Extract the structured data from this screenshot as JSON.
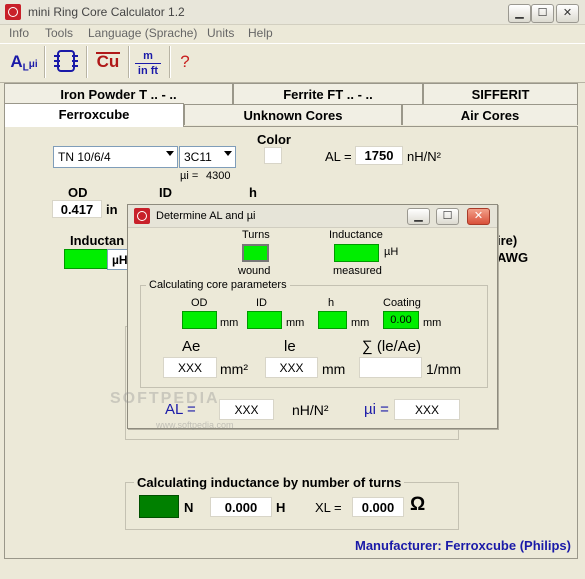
{
  "window": {
    "title": "mini Ring Core Calculator 1.2",
    "min_glyph": "▁",
    "max_glyph": "☐",
    "close_glyph": "✕"
  },
  "menu": [
    "Info",
    "Tools",
    "Language (Sprache)",
    "Units",
    "Help"
  ],
  "toolbar": {
    "al_main": "A",
    "al_sub": "L",
    "mu": "μi",
    "cu": "Cu",
    "m_top": "m",
    "m_bottom": "in ft",
    "help": "?"
  },
  "tabs_row1": [
    "Iron Powder T .. - ..",
    "Ferrite FT .. - ..",
    "SIFFERIT"
  ],
  "tabs_row2": [
    "Ferroxcube",
    "Unknown Cores",
    "Air Cores"
  ],
  "main": {
    "core_select": "TN 10/6/4",
    "material_select": "3C11",
    "mu_label": "µi =",
    "mu_value": "4300",
    "color_label": "Color",
    "al_label": "AL =",
    "al_value": "1750",
    "al_unit": "nH/N²",
    "od_label": "OD",
    "od_value": "0.417",
    "od_unit": "in",
    "id_label": "ID",
    "h_label": "h",
    "inductance_label_partial": "Inductan",
    "uh_partial": "µH",
    "wire_partial": "ire)",
    "awg_partial": "AWG",
    "calc_by_turns_title": "Calculating inductance by number of turns",
    "n_label": "N",
    "n_value": "0.000",
    "h_unit": "H",
    "xl_label": "XL =",
    "xl_value": "0.000",
    "ohm": "Ω",
    "manufacturer": "Manufacturer: Ferroxcube (Philips)"
  },
  "dialog": {
    "title": "Determine AL and µi",
    "turns_label": "Turns",
    "wound_label": "wound",
    "inductance_label": "Inductance",
    "measured_label": "measured",
    "uh_unit": "µH",
    "calc_params_title": "Calculating core parameters",
    "od_label": "OD",
    "id_label": "ID",
    "h_label": "h",
    "coating_label": "Coating",
    "coating_value": "0.00",
    "mm": "mm",
    "ae_label": "Ae",
    "le_label": "le",
    "sum_label": "∑ (le/Ae)",
    "ae_value": "XXX",
    "ae_unit": "mm²",
    "le_value": "XXX",
    "le_unit": "mm",
    "sum_unit": "1/mm",
    "al_label": "AL =",
    "al_value": "XXX",
    "al_unit": "nH/N²",
    "mui_label": "µi =",
    "mui_value": "XXX"
  },
  "watermark": "SOFTPEDIA",
  "watermark_url": "www.softpedia.com",
  "colors": {
    "green": "#00ee00",
    "dark_green": "#008000",
    "accent_blue": "#1a1aa8"
  }
}
